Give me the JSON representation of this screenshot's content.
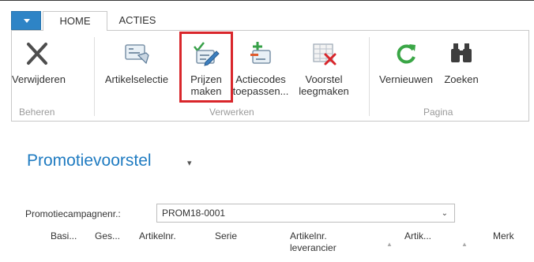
{
  "tabs": {
    "home": "HOME",
    "acties": "ACTIES"
  },
  "ribbon": {
    "buttons": {
      "verwijderen": "Verwijderen",
      "artikelselectie": "Artikelselectie",
      "prijzen_line1": "Prijzen",
      "prijzen_line2": "maken",
      "actiecodes_line1": "Actiecodes",
      "actiecodes_line2": "toepassen...",
      "voorstel_line1": "Voorstel",
      "voorstel_line2": "leegmaken",
      "vernieuwen": "Vernieuwen",
      "zoeken": "Zoeken"
    },
    "groups": {
      "beheren": "Beheren",
      "verwerken": "Verwerken",
      "pagina": "Pagina"
    }
  },
  "page": {
    "title": "Promotievoorstel",
    "title_caret": "▾"
  },
  "form": {
    "campaign_label": "Promotiecampagnenr.:",
    "campaign_value": "PROM18-0001"
  },
  "grid": {
    "columns": {
      "basi": "Basi...",
      "ges": "Ges...",
      "artikelnr": "Artikelnr.",
      "serie": "Serie",
      "artikelnr_lev_line1": "Artikelnr.",
      "artikelnr_lev_line2": "leverancier",
      "artik": "Artik...",
      "merk": "Merk"
    }
  },
  "colors": {
    "accent": "#1f7bc1",
    "app_button": "#2e84c6",
    "highlight": "#d9262b",
    "group_label": "#9a9a9a"
  }
}
